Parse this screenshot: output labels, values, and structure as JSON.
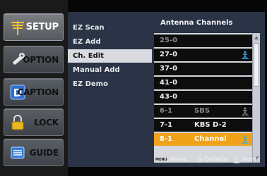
{
  "categories": [
    {
      "label": "SETUP",
      "icon": "antenna-icon",
      "active": true
    },
    {
      "label": "OPTION",
      "icon": "wrench-icon",
      "active": false
    },
    {
      "label": "CAPTION",
      "icon": "caption-icon",
      "active": false
    },
    {
      "label": "LOCK",
      "icon": "lock-icon",
      "active": false
    },
    {
      "label": "GUIDE",
      "icon": "guide-icon",
      "active": false
    }
  ],
  "menu": [
    {
      "label": "EZ Scan",
      "active": false
    },
    {
      "label": "EZ Add",
      "active": false
    },
    {
      "label": "Ch. Edit",
      "active": true
    },
    {
      "label": "Manual Add",
      "active": false
    },
    {
      "label": "EZ Demo",
      "active": false
    }
  ],
  "panel": {
    "title": "Antenna Channels",
    "channels": [
      {
        "number": "25-0",
        "name": "",
        "surf": false,
        "dim": true,
        "selected": false
      },
      {
        "number": "27-0",
        "name": "",
        "surf": true,
        "dim": false,
        "selected": false
      },
      {
        "number": "37-0",
        "name": "",
        "surf": false,
        "dim": false,
        "selected": false
      },
      {
        "number": "41-0",
        "name": "",
        "surf": false,
        "dim": false,
        "selected": false
      },
      {
        "number": "43-0",
        "name": "",
        "surf": false,
        "dim": false,
        "selected": false
      },
      {
        "number": "6-1",
        "name": "SBS",
        "surf": true,
        "dim": true,
        "selected": false
      },
      {
        "number": "7-1",
        "name": "KBS D-2",
        "surf": false,
        "dim": false,
        "selected": false
      },
      {
        "number": "8-1",
        "name": "Channel",
        "surf": true,
        "dim": false,
        "selected": true
      }
    ]
  },
  "hints": {
    "menu_key": "MENU",
    "prev": "Prev.",
    "delete": "Delete",
    "surf": "Surf"
  },
  "colors": {
    "panel_bg": "#2a3446",
    "selected_row": "#f0a21a",
    "surf_icon": "#3aa7e0"
  }
}
